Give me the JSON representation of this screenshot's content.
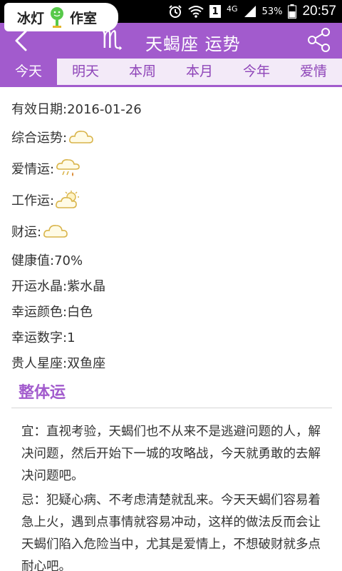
{
  "status_bar": {
    "network": "4G",
    "sim_label": "1",
    "battery": "53%",
    "time": "20:57"
  },
  "watermark": {
    "text": "冰灯",
    "text2": "作室"
  },
  "header": {
    "zodiac_symbol": "♏",
    "title": "天蝎座 运势"
  },
  "tabs": [
    {
      "label": "今天",
      "active": true
    },
    {
      "label": "明天",
      "active": false
    },
    {
      "label": "本周",
      "active": false
    },
    {
      "label": "本月",
      "active": false
    },
    {
      "label": "今年",
      "active": false
    },
    {
      "label": "爱情",
      "active": false
    }
  ],
  "info": {
    "valid_date": "有效日期:2016-01-26",
    "overall": "综合运势:",
    "love": "爱情运:",
    "work": "工作运:",
    "wealth": "财运:",
    "health": "健康值:70%",
    "crystal": "开运水晶:紫水晶",
    "lucky_color": "幸运颜色:白色",
    "lucky_number": "幸运数字:1",
    "noble_sign": "贵人星座:双鱼座"
  },
  "weather_icons": {
    "overall": "cloud-icon",
    "love": "rain-cloud-icon",
    "work": "sun-cloud-icon",
    "wealth": "cloud-icon"
  },
  "section": {
    "title": "整体运",
    "yi": "宜：直视考验，天蝎们也不从来不是逃避问题的人，解决问题，然后开始下一城的攻略战，今天就勇敢的去解决问题吧。",
    "ji": "忌：犯疑心病、不考虑清楚就乱来。今天天蝎们容易着急上火，遇到点事情就容易冲动，这样的做法反而会让天蝎们陷入危险当中，尤其是爱情上，不想破财就多点耐心吧。"
  },
  "colors": {
    "accent": "#a25bcd",
    "tab_bg": "#f3eaf8",
    "text": "#333333"
  }
}
